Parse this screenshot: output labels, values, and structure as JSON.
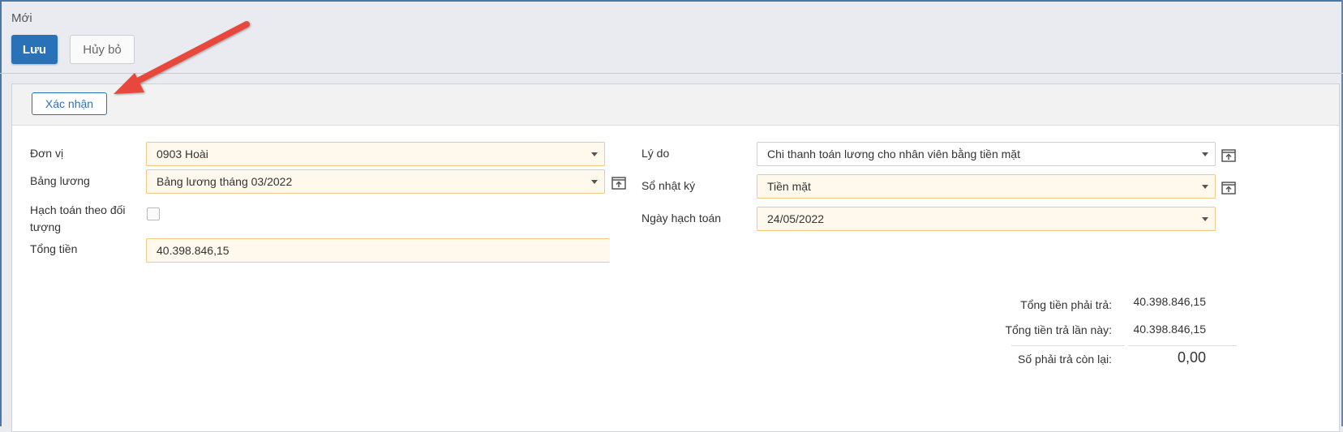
{
  "header": {
    "breadcrumb": "Mới",
    "save_label": "Lưu",
    "cancel_label": "Hủy bỏ"
  },
  "toolbar": {
    "confirm_label": "Xác nhận"
  },
  "form": {
    "unit_label": "Đơn vị",
    "unit_value": "0903 Hoài",
    "payroll_label": "Bảng lương",
    "payroll_value": "Bảng lương tháng 03/2022",
    "account_by_object_label": "Hạch toán theo đối tượng",
    "account_by_object_checked": false,
    "total_label": "Tổng tiền",
    "total_value": "40.398.846,15",
    "reason_label": "Lý do",
    "reason_value": "Chi thanh toán lương cho nhân viên bằng tiền mặt",
    "journal_label": "Sổ nhật ký",
    "journal_value": "Tiền mặt",
    "posting_date_label": "Ngày hạch toán",
    "posting_date_value": "24/05/2022"
  },
  "summary": {
    "total_payable_label": "Tổng tiền phải trả:",
    "total_payable_value": "40.398.846,15",
    "paid_this_time_label": "Tổng tiền trả lần này:",
    "paid_this_time_value": "40.398.846,15",
    "remaining_label": "Số phải trả còn lại:",
    "remaining_value": "0,00"
  },
  "icons": {
    "open_external": "open-external-icon",
    "dropdown": "chevron-down-icon",
    "annotation": "red-arrow-annotation"
  },
  "colors": {
    "primary": "#2a72b8",
    "required_field_bg": "#fff8ec",
    "required_field_border": "#f0c98a",
    "annotation_arrow": "#e8473b"
  }
}
